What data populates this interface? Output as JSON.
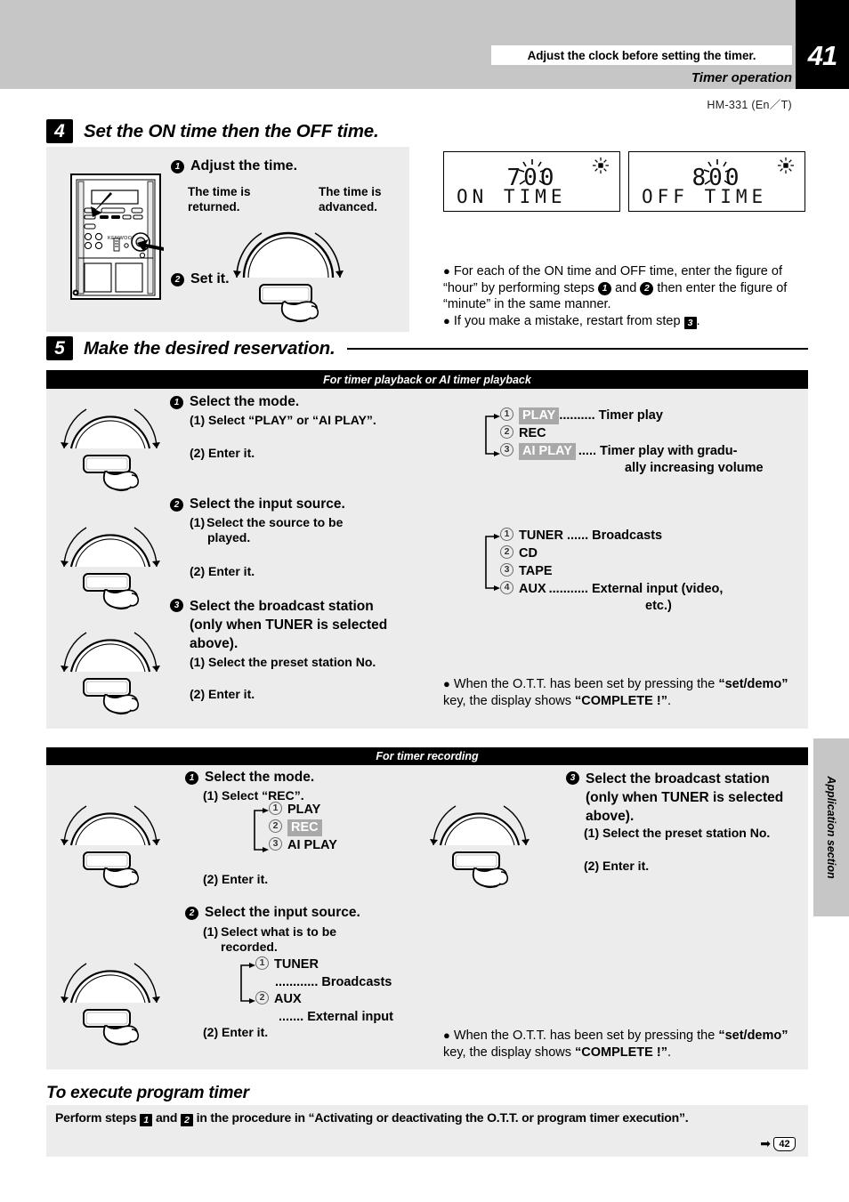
{
  "header": {
    "notice": "Adjust the clock before setting the timer.",
    "section_title": "Timer operation",
    "page_number": "41",
    "model": "HM-331 (En／T)"
  },
  "side_tab": {
    "label": "Application section"
  },
  "step4": {
    "badge": "4",
    "title": "Set the ON time then the OFF time.",
    "sub1_num": "❶",
    "sub1_title": "Adjust the time.",
    "dial_left_label": "The time is\nreturned.",
    "dial_left_line1": "The time is",
    "dial_left_line2": "returned.",
    "dial_right_line1": "The time is",
    "dial_right_line2": "advanced.",
    "sub2_num": "❷",
    "sub2_title": "Set it.",
    "lcd_on": {
      "value": "700",
      "label": "ON TIME"
    },
    "lcd_off": {
      "value": "800",
      "label": "OFF TIME"
    },
    "note1_a": "For each of the ON time and OFF time, enter the figure of “hour” by performing steps",
    "note1_step1": "1",
    "note1_b": "and",
    "note1_step2": "2",
    "note1_c": "then enter the figure of “minute” in the same manner.",
    "note2_a": "If you make a mistake, restart from step",
    "note2_step": "3",
    "note2_b": "."
  },
  "step5": {
    "badge": "5",
    "title": "Make the desired reservation.",
    "playback": {
      "bar_label": "For timer playback or AI timer playback",
      "item1": {
        "num": "1",
        "title": "Select the mode.",
        "line1": "(1) Select “PLAY” or “AI PLAY”.",
        "line2": "(2) Enter it."
      },
      "item2": {
        "num": "2",
        "title": "Select the input source.",
        "line1a": "(1)",
        "line1b": "Select  the  source  to  be",
        "line1c": "played.",
        "line2": "(2) Enter it."
      },
      "item3": {
        "num": "3",
        "title_l1": "Select  the  broadcast  station",
        "title_l2": "(only when TUNER is selected",
        "title_l3": "above).",
        "line1": "(1) Select the preset station No.",
        "line2": "(2) Enter it."
      },
      "modes": [
        {
          "n": "1",
          "name": "PLAY",
          "highlight": true,
          "dots": "..........",
          "desc": "Timer play",
          "desc2": ""
        },
        {
          "n": "2",
          "name": "REC",
          "highlight": false,
          "dots": "",
          "desc": "",
          "desc2": ""
        },
        {
          "n": "3",
          "name": "AI PLAY",
          "highlight": true,
          "dots": ".....",
          "desc": "Timer play with gradu-",
          "desc2": "ally increasing volume"
        }
      ],
      "sources": [
        {
          "n": "1",
          "name": "TUNER",
          "dots": "......",
          "desc": "Broadcasts",
          "desc2": ""
        },
        {
          "n": "2",
          "name": "CD",
          "dots": "",
          "desc": "",
          "desc2": ""
        },
        {
          "n": "3",
          "name": "TAPE",
          "dots": "",
          "desc": "",
          "desc2": ""
        },
        {
          "n": "4",
          "name": "AUX",
          "dots": "...........",
          "desc": "External  input  (video,",
          "desc2": "etc.)"
        }
      ],
      "note_a": "When the O.T.T. has been set by pressing the",
      "note_b": "“set/demo”",
      "note_c": "key, the display shows",
      "note_d": "“COMPLETE !”",
      "note_e": "."
    },
    "recording": {
      "bar_label": "For timer recording",
      "item1": {
        "num": "1",
        "title": "Select the mode.",
        "line1": "(1) Select “REC”.",
        "line2": "(2) Enter it."
      },
      "item2": {
        "num": "2",
        "title": "Select the input source.",
        "line1a": "(1)",
        "line1b": "Select what is to be",
        "line1c": "recorded.",
        "line2": "(2) Enter it."
      },
      "item3": {
        "num": "3",
        "title_l1": "Select the broadcast station",
        "title_l2": "(only when TUNER is selected",
        "title_l3": "above).",
        "line1": "(1) Select the preset station No.",
        "line2": "(2) Enter it."
      },
      "modes": [
        {
          "n": "1",
          "name": "PLAY",
          "highlight": false
        },
        {
          "n": "2",
          "name": "REC",
          "highlight": true
        },
        {
          "n": "3",
          "name": "AI PLAY",
          "highlight": false
        }
      ],
      "sources": [
        {
          "n": "1",
          "name": "TUNER",
          "dots": "............",
          "desc": "Broadcasts"
        },
        {
          "n": "2",
          "name": "AUX",
          "dots": ".......",
          "desc": "External input"
        }
      ],
      "note_a": "When the O.T.T. has been set by pressing the",
      "note_b": "“set/",
      "note_b2": "demo”",
      "note_c": "key, the display shows",
      "note_d": "“COMPLETE !”",
      "note_e": "."
    }
  },
  "execute": {
    "title": "To execute program timer",
    "text_a": "Perform steps",
    "step1": "1",
    "text_b": "and",
    "step2": "2",
    "text_c": "in the procedure in “Activating or deactivating the O.T.T. or program timer execution”.",
    "page_ref": "42"
  },
  "colors": {
    "panel_gray": "#ececec",
    "band_gray": "#c6c6c6",
    "highlight_gray": "#a8a8a8",
    "black": "#000000"
  }
}
